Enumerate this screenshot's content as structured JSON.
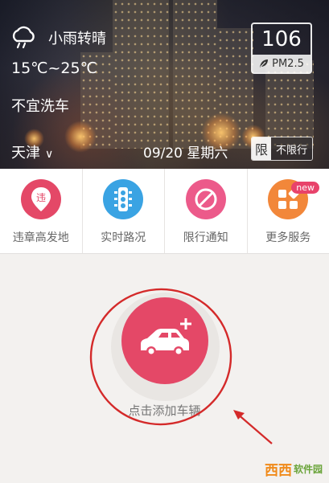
{
  "weather": {
    "description": "小雨转晴",
    "temperature": "15℃~25℃",
    "advice": "不宜洗车",
    "city": "天津",
    "date": "09/20 星期六"
  },
  "air_quality": {
    "value": "106",
    "label": "PM2.5"
  },
  "restriction": {
    "tag": "限",
    "status": "不限行"
  },
  "quick_nav": [
    {
      "label": "违章高发地",
      "icon": "violation-pin-icon",
      "color": "#e44867",
      "glyph": "违"
    },
    {
      "label": "实时路况",
      "icon": "traffic-light-icon",
      "color": "#3aa3e3"
    },
    {
      "label": "限行通知",
      "icon": "no-entry-icon",
      "color": "#ec5a8a"
    },
    {
      "label": "更多服务",
      "icon": "grid-icon",
      "color": "#f2873a",
      "badge": "new"
    }
  ],
  "add_vehicle": {
    "label": "点击添加车辆"
  },
  "watermark": {
    "logo": "西西",
    "text": "软件园"
  },
  "colors": {
    "accent": "#e44867",
    "annotation": "#d42a2a"
  }
}
